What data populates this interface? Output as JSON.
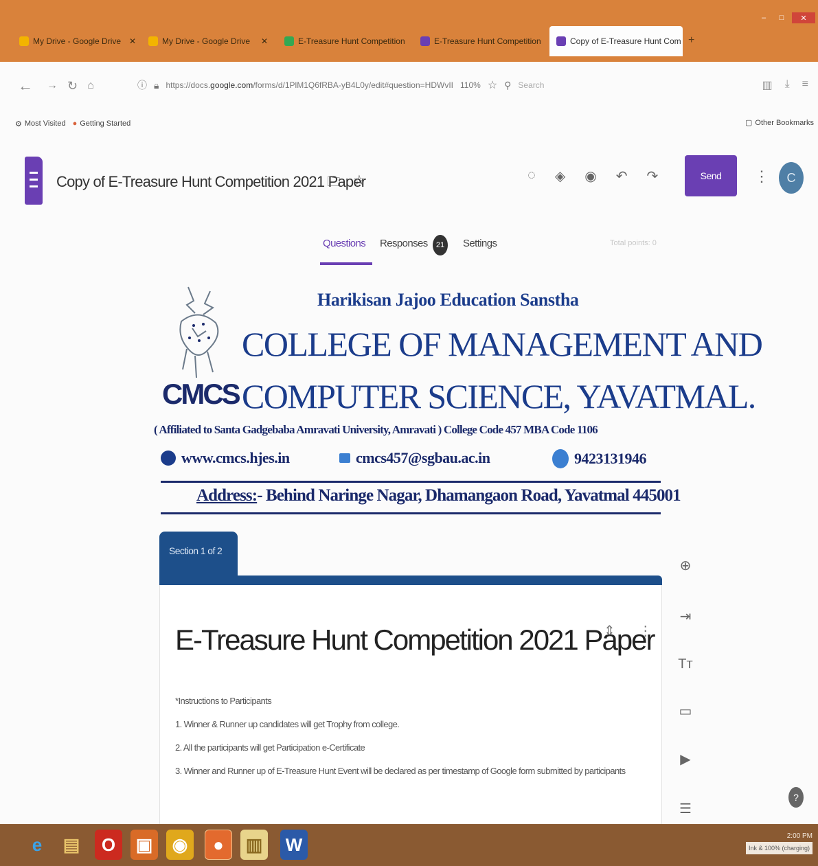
{
  "browser": {
    "tabs": [
      {
        "title": "My Drive - Google Drive",
        "favicon_color": "#f3b400"
      },
      {
        "title": "My Drive - Google Drive",
        "favicon_color": "#f3b400"
      },
      {
        "title": "E-Treasure Hunt Competition",
        "favicon_color": "#34a853"
      },
      {
        "title": "E-Treasure Hunt Competition",
        "favicon_color": "#6a3fb3"
      },
      {
        "title": "Copy of E-Treasure Hunt Com",
        "favicon_color": "#6a3fb3"
      }
    ],
    "url_prefix": "https://docs.",
    "url_domain": "google.com",
    "url_path": "/forms/d/1PlM1Q6fRBA-yB4L0y/edit#question=HDWvII",
    "zoom": "110%",
    "search_placeholder": "Search",
    "bookmarks": [
      "Most Visited",
      "Getting Started"
    ],
    "other_bookmarks": "Other Bookmarks"
  },
  "forms": {
    "doc_title": "Copy of E-Treasure Hunt Competition 2021 Paper",
    "send_label": "Send",
    "avatar_letter": "C",
    "tabs": {
      "questions": "Questions",
      "responses": "Responses",
      "responses_count": "21",
      "settings": "Settings"
    },
    "total_points": "Total points: 0"
  },
  "college": {
    "sanstha": "Harikisan Jajoo Education Sanstha",
    "name_line1": "COLLEGE OF MANAGEMENT AND",
    "name_line2": "COMPUTER SCIENCE, YAVATMAL.",
    "logo_text": "CMCS",
    "affiliation": "( Affiliated to Santa Gadgebaba Amravati University, Amravati ) College Code 457   MBA Code 1106",
    "website": "www.cmcs.hjes.in",
    "email": "cmcs457@sgbau.ac.in",
    "phone": "9423131946",
    "address_label": "Address:",
    "address": "- Behind Naringe Nagar, Dhamangaon Road, Yavatmal 445001"
  },
  "section": {
    "label": "Section 1 of 2"
  },
  "form": {
    "title": "E-Treasure Hunt Competition 2021 Paper",
    "instructions_heading": "*Instructions to Participants",
    "instructions": [
      "1. Winner & Runner up candidates will get Trophy from college.",
      "2. All the participants will get Participation e-Certificate",
      "3. Winner and Runner up of E-Treasure Hunt Event will be declared as per timestamp of Google form submitted by participants"
    ]
  },
  "taskbar": {
    "time": "2:00 PM",
    "tray_note": "Ink & 100% (charging)"
  },
  "colors": {
    "forms_purple": "#6a3fb3",
    "section_blue": "#1d4f8a",
    "college_navy": "#1b3c8b",
    "tabbar_orange": "#d9823b"
  }
}
